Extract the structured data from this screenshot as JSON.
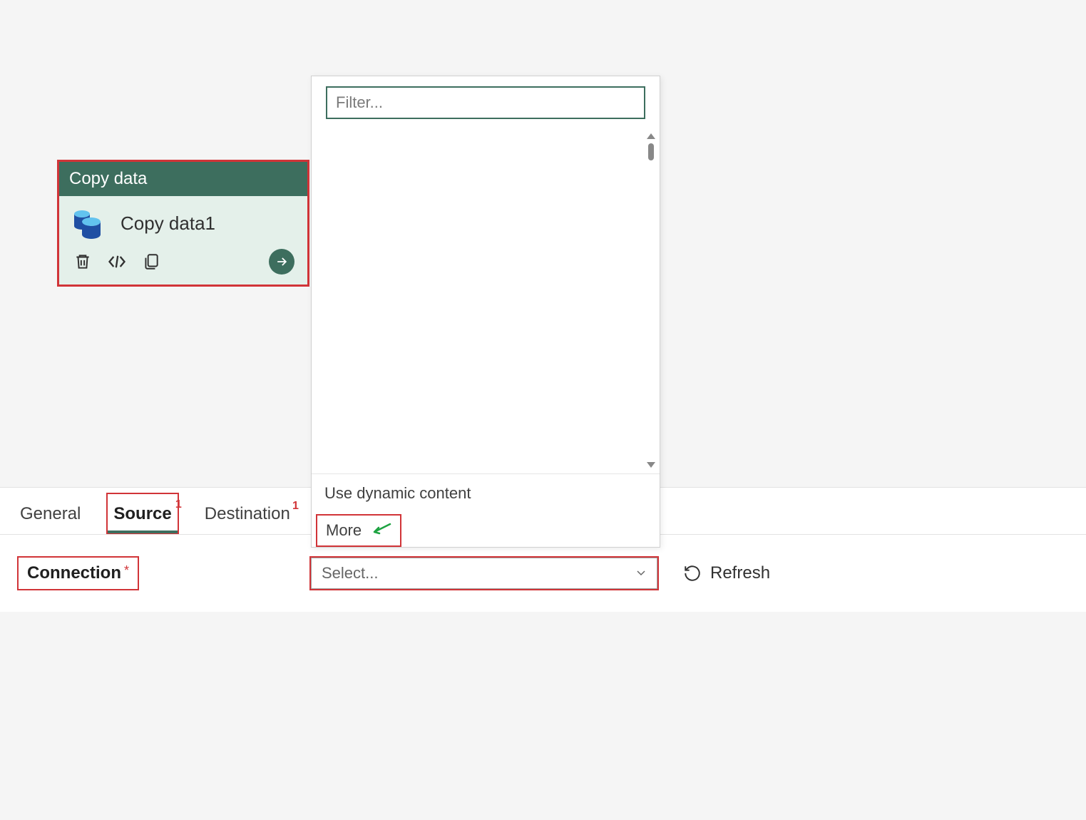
{
  "activity": {
    "title": "Copy data",
    "name": "Copy data1"
  },
  "dropdown": {
    "filter_placeholder": "Filter...",
    "dynamic_content": "Use dynamic content",
    "more": "More"
  },
  "tabs": {
    "general": "General",
    "source": "Source",
    "source_badge": "1",
    "destination": "Destination",
    "destination_badge": "1"
  },
  "form": {
    "connection_label": "Connection",
    "select_placeholder": "Select...",
    "refresh": "Refresh"
  }
}
